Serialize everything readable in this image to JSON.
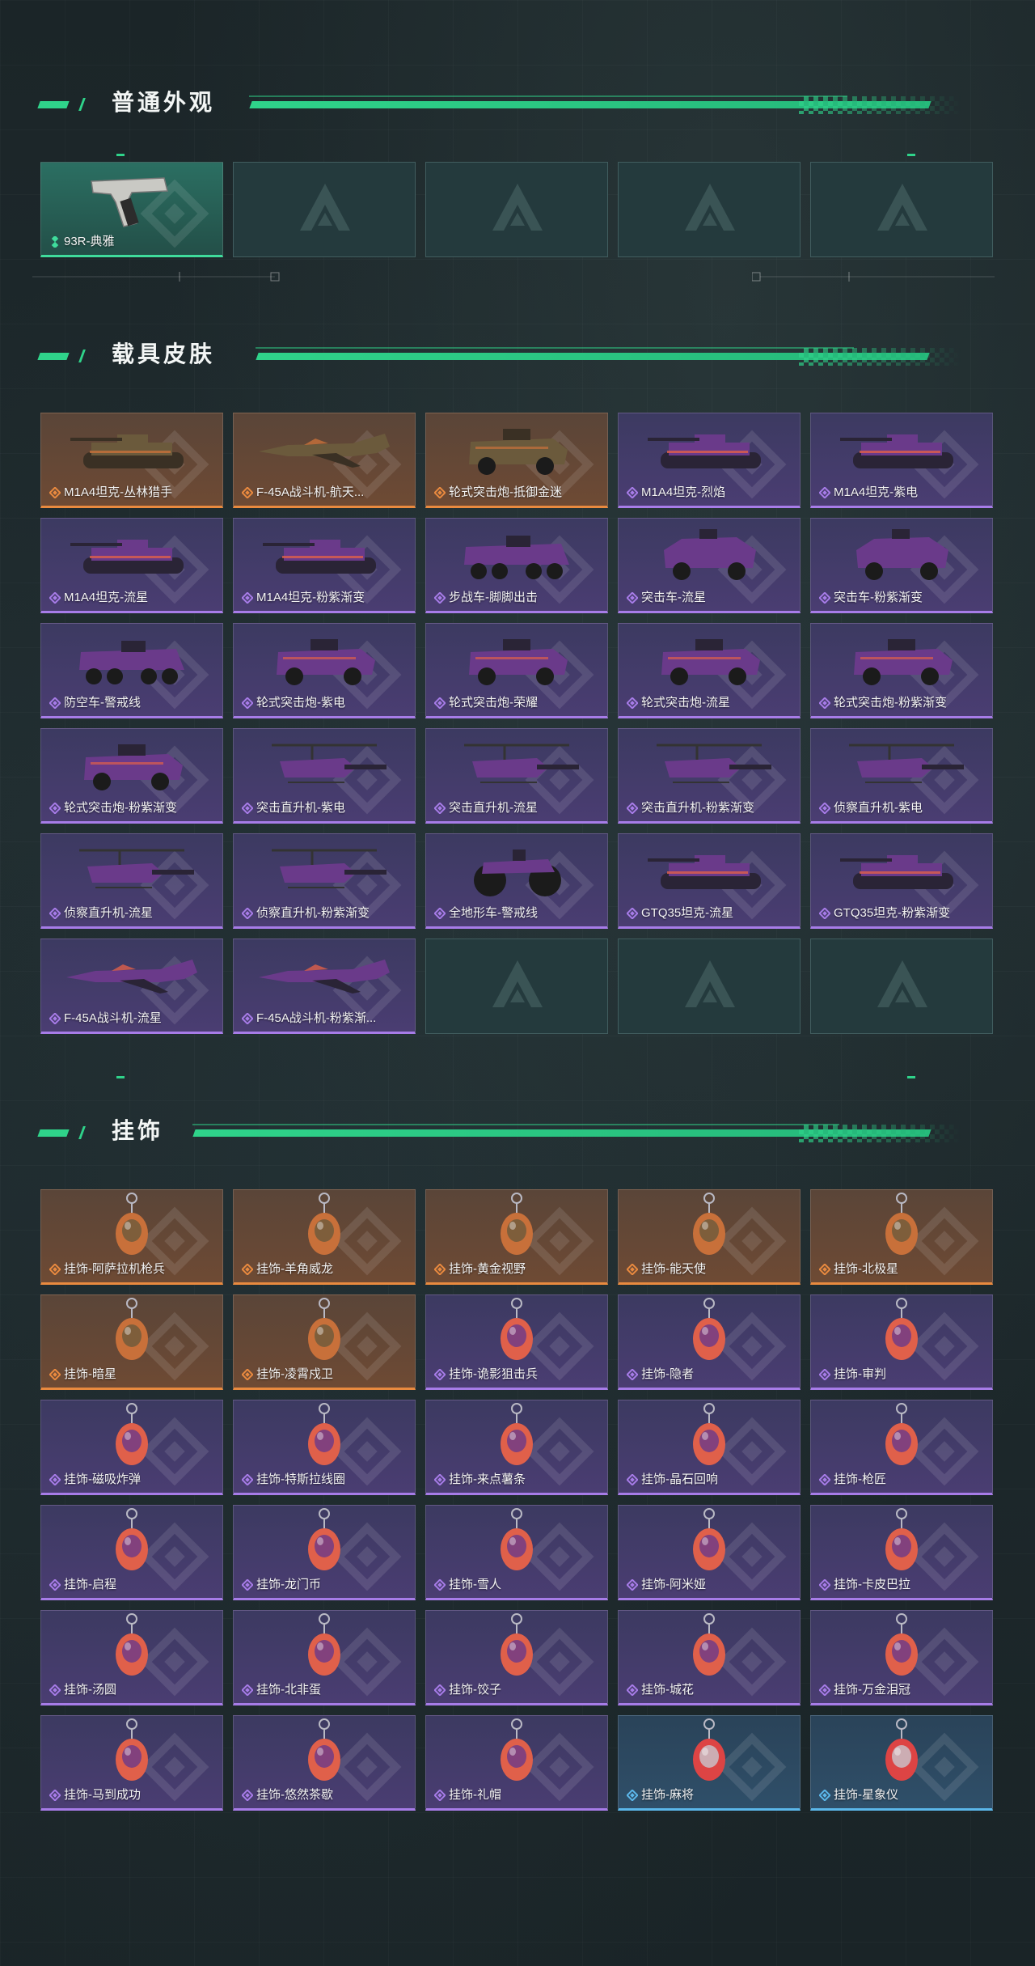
{
  "sections": {
    "normal": {
      "title": "普通外观",
      "items": [
        {
          "label": "93R-典雅",
          "rarity": "green",
          "icon": "pistol-icon"
        }
      ]
    },
    "vehicle": {
      "title": "载具皮肤",
      "items": [
        {
          "label": "M1A4坦克-丛林猎手",
          "rarity": "orange",
          "icon": "tank-icon"
        },
        {
          "label": "F-45A战斗机-航天...",
          "rarity": "orange",
          "icon": "jet-icon"
        },
        {
          "label": "轮式突击炮-抵御金迷",
          "rarity": "orange",
          "icon": "armored-car-icon"
        },
        {
          "label": "M1A4坦克-烈焰",
          "rarity": "purple",
          "icon": "tank-icon"
        },
        {
          "label": "M1A4坦克-紫电",
          "rarity": "purple",
          "icon": "tank-icon"
        },
        {
          "label": "M1A4坦克-流星",
          "rarity": "purple",
          "icon": "tank-icon"
        },
        {
          "label": "M1A4坦克-粉紫渐变",
          "rarity": "purple",
          "icon": "tank-icon"
        },
        {
          "label": "步战车-脚脚出击",
          "rarity": "purple",
          "icon": "apc-icon"
        },
        {
          "label": "突击车-流星",
          "rarity": "purple",
          "icon": "assault-vehicle-icon"
        },
        {
          "label": "突击车-粉紫渐变",
          "rarity": "purple",
          "icon": "assault-vehicle-icon"
        },
        {
          "label": "防空车-警戒线",
          "rarity": "purple",
          "icon": "apc-icon"
        },
        {
          "label": "轮式突击炮-紫电",
          "rarity": "purple",
          "icon": "armored-car-icon"
        },
        {
          "label": "轮式突击炮-荣耀",
          "rarity": "purple",
          "icon": "armored-car-icon"
        },
        {
          "label": "轮式突击炮-流星",
          "rarity": "purple",
          "icon": "armored-car-icon"
        },
        {
          "label": "轮式突击炮-粉紫渐变",
          "rarity": "purple",
          "icon": "armored-car-icon"
        },
        {
          "label": "轮式突击炮-粉紫渐变",
          "rarity": "purple",
          "icon": "armored-car-icon"
        },
        {
          "label": "突击直升机-紫电",
          "rarity": "purple",
          "icon": "helicopter-icon"
        },
        {
          "label": "突击直升机-流星",
          "rarity": "purple",
          "icon": "helicopter-icon"
        },
        {
          "label": "突击直升机-粉紫渐变",
          "rarity": "purple",
          "icon": "helicopter-icon"
        },
        {
          "label": "侦察直升机-紫电",
          "rarity": "purple",
          "icon": "helicopter-icon"
        },
        {
          "label": "侦察直升机-流星",
          "rarity": "purple",
          "icon": "helicopter-icon"
        },
        {
          "label": "侦察直升机-粉紫渐变",
          "rarity": "purple",
          "icon": "helicopter-icon"
        },
        {
          "label": "全地形车-警戒线",
          "rarity": "purple",
          "icon": "atv-icon"
        },
        {
          "label": "GTQ35坦克-流星",
          "rarity": "purple",
          "icon": "tank-icon"
        },
        {
          "label": "GTQ35坦克-粉紫渐变",
          "rarity": "purple",
          "icon": "tank-icon"
        },
        {
          "label": "F-45A战斗机-流星",
          "rarity": "purple",
          "icon": "jet-icon"
        },
        {
          "label": "F-45A战斗机-粉紫渐...",
          "rarity": "purple",
          "icon": "jet-icon"
        }
      ]
    },
    "charm": {
      "title": "挂饰",
      "items": [
        {
          "label": "挂饰-阿萨拉机枪兵",
          "rarity": "orange",
          "icon": "soldier-charm-icon"
        },
        {
          "label": "挂饰-羊角威龙",
          "rarity": "orange",
          "icon": "figure-charm-icon"
        },
        {
          "label": "挂饰-黄金视野",
          "rarity": "orange",
          "icon": "figure-charm-icon"
        },
        {
          "label": "挂饰-能天使",
          "rarity": "orange",
          "icon": "tag-charm-icon"
        },
        {
          "label": "挂饰-北极星",
          "rarity": "orange",
          "icon": "star-charm-icon"
        },
        {
          "label": "挂饰-暗星",
          "rarity": "orange",
          "icon": "bird-charm-icon"
        },
        {
          "label": "挂饰-凌霄戍卫",
          "rarity": "orange",
          "icon": "figure-charm-icon"
        },
        {
          "label": "挂饰-诡影狙击兵",
          "rarity": "purple",
          "icon": "figure-charm-icon"
        },
        {
          "label": "挂饰-隐者",
          "rarity": "purple",
          "icon": "card-charm-icon"
        },
        {
          "label": "挂饰-审判",
          "rarity": "purple",
          "icon": "card-charm-icon"
        },
        {
          "label": "挂饰-磁吸炸弹",
          "rarity": "purple",
          "icon": "bomb-charm-icon"
        },
        {
          "label": "挂饰-特斯拉线圈",
          "rarity": "purple",
          "icon": "coil-charm-icon"
        },
        {
          "label": "挂饰-来点薯条",
          "rarity": "purple",
          "icon": "fries-charm-icon"
        },
        {
          "label": "挂饰-晶石回响",
          "rarity": "purple",
          "icon": "crystal-charm-icon"
        },
        {
          "label": "挂饰-枪匠",
          "rarity": "purple",
          "icon": "vest-charm-icon"
        },
        {
          "label": "挂饰-启程",
          "rarity": "purple",
          "icon": "badge-charm-icon"
        },
        {
          "label": "挂饰-龙门币",
          "rarity": "purple",
          "icon": "bottle-charm-icon"
        },
        {
          "label": "挂饰-雪人",
          "rarity": "purple",
          "icon": "snowman-charm-icon"
        },
        {
          "label": "挂饰-阿米娅",
          "rarity": "purple",
          "icon": "figure-charm-icon"
        },
        {
          "label": "挂饰-卡皮巴拉",
          "rarity": "purple",
          "icon": "capybara-charm-icon"
        },
        {
          "label": "挂饰-汤圆",
          "rarity": "purple",
          "icon": "bowl-charm-icon"
        },
        {
          "label": "挂饰-北非蛋",
          "rarity": "purple",
          "icon": "pan-charm-icon"
        },
        {
          "label": "挂饰-饺子",
          "rarity": "purple",
          "icon": "dumpling-charm-icon"
        },
        {
          "label": "挂饰-城花",
          "rarity": "purple",
          "icon": "flower-charm-icon"
        },
        {
          "label": "挂饰-万金泪冠",
          "rarity": "purple",
          "icon": "crown-charm-icon"
        },
        {
          "label": "挂饰-马到成功",
          "rarity": "purple",
          "icon": "horse-charm-icon"
        },
        {
          "label": "挂饰-悠然茶歇",
          "rarity": "purple",
          "icon": "cupcake-charm-icon"
        },
        {
          "label": "挂饰-礼帽",
          "rarity": "purple",
          "icon": "hat-charm-icon"
        },
        {
          "label": "挂饰-麻将",
          "rarity": "blue",
          "icon": "mahjong-charm-icon"
        },
        {
          "label": "挂饰-星象仪",
          "rarity": "blue",
          "icon": "orrery-charm-icon"
        }
      ]
    }
  },
  "colors": {
    "accent": "#2fd38a",
    "green": "#3fdc9c",
    "orange": "#e98a3f",
    "purple": "#a77ce8",
    "blue": "#5bb7ea"
  }
}
